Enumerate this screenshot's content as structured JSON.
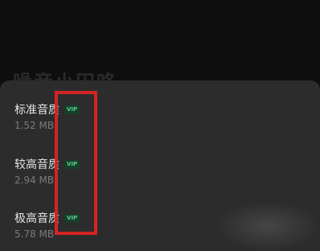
{
  "background": {
    "title": "噪音小田咯"
  },
  "quality_options": [
    {
      "label": "标准音质",
      "badge": "VIP",
      "size": "1.52 MB"
    },
    {
      "label": "较高音质",
      "badge": "VIP",
      "size": "2.94 MB"
    },
    {
      "label": "极高音质",
      "badge": "VIP",
      "size": "5.78 MB"
    }
  ],
  "colors": {
    "highlight": "#d42424",
    "vip_badge_bg": "#16402a",
    "vip_badge_text": "#5ec98a"
  }
}
